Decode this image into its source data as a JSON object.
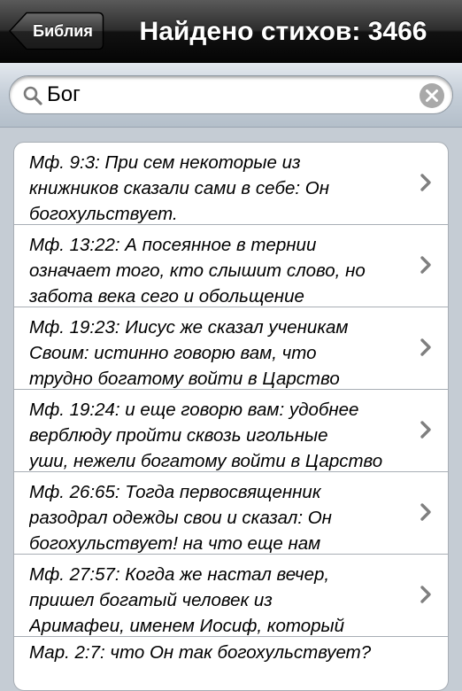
{
  "navbar": {
    "back_label": "Библия",
    "title": "Найдено стихов: 3466"
  },
  "search": {
    "value": "Бог",
    "search_icon": "search-icon",
    "clear_icon": "clear-icon"
  },
  "results": [
    {
      "text": "Мф. 9:3: При сем некоторые из\nкнижников сказали сами в себе: Он\nбогохульствует."
    },
    {
      "text": "Мф. 13:22: А посеянное в тернии\nозначает того, кто слышит слово, но\nзабота века сего и обольщение"
    },
    {
      "text": "Мф. 19:23: Иисус же сказал ученикам\nСвоим: истинно говорю вам, что\nтрудно богатому войти в Царство"
    },
    {
      "text": "Мф. 19:24: и еще говорю вам: удобнее\nверблюду пройти сквозь игольные\nуши, нежели богатому войти в Царство"
    },
    {
      "text": "Мф. 26:65: Тогда первосвященник\nразодрал одежды свои и сказал: Он\nбогохульствует! на что еще нам"
    },
    {
      "text": "Мф. 27:57: Когда же настал вечер,\nпришел богатый человек из\nАримафеи, именем Иосиф, который"
    },
    {
      "text": "Мар. 2:7: что Он так богохульствует?"
    }
  ]
}
